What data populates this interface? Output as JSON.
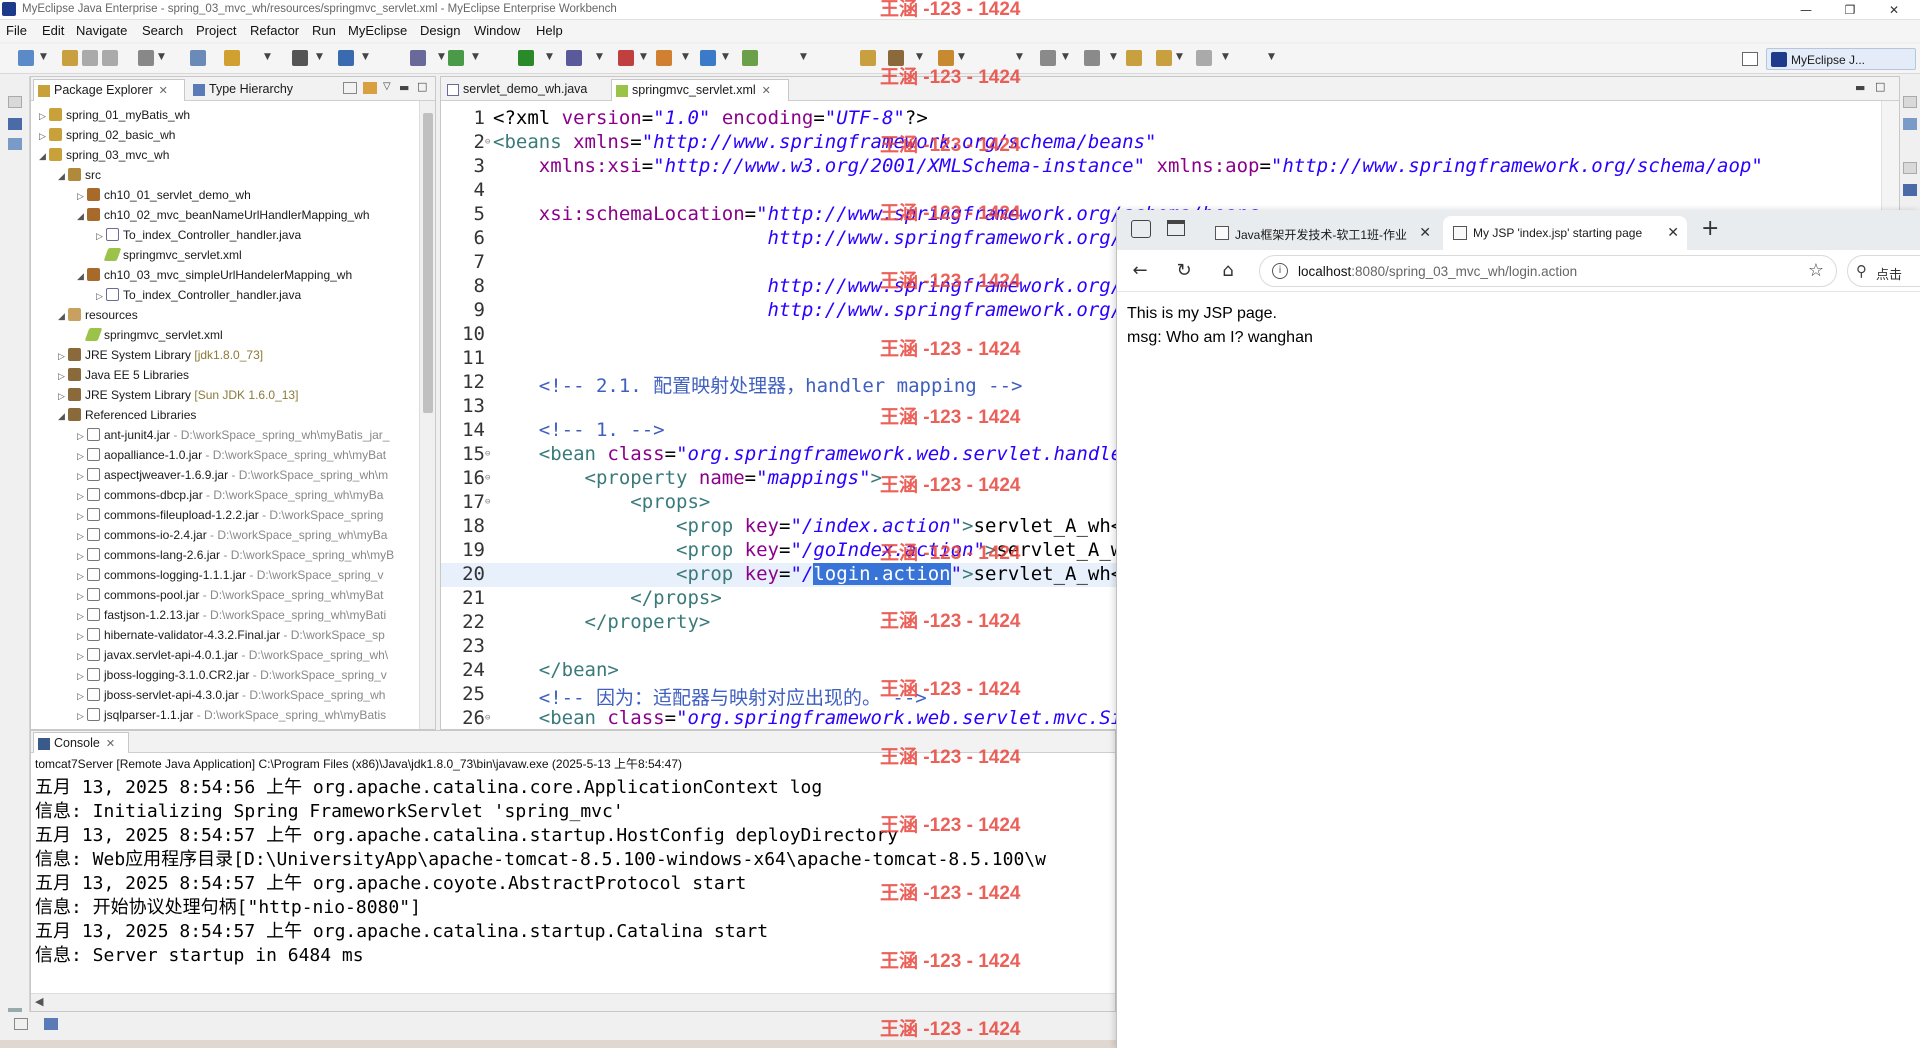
{
  "window": {
    "title": "MyEclipse Java Enterprise - spring_03_mvc_wh/resources/springmvc_servlet.xml - MyEclipse Enterprise Workbench",
    "controls": [
      "—",
      "❐",
      "✕"
    ]
  },
  "menu": [
    "File",
    "Edit",
    "Navigate",
    "Search",
    "Project",
    "Refactor",
    "Run",
    "MyEclipse",
    "Design",
    "Window",
    "Help"
  ],
  "perspective": "MyEclipse J...",
  "package_explorer": {
    "tabs": [
      "Package Explorer",
      "Type Hierarchy"
    ],
    "tree": [
      {
        "label": "spring_01_myBatis_wh",
        "icon": "project-icon",
        "indent": 0,
        "twisty": "▷"
      },
      {
        "label": "spring_02_basic_wh",
        "icon": "project-icon",
        "indent": 0,
        "twisty": "▷"
      },
      {
        "label": "spring_03_mvc_wh",
        "icon": "project-icon",
        "indent": 0,
        "twisty": "◢"
      },
      {
        "label": "src",
        "icon": "source-folder-icon",
        "indent": 1,
        "twisty": "◢"
      },
      {
        "label": "ch10_01_servlet_demo_wh",
        "icon": "package-icon",
        "indent": 2,
        "twisty": "▷"
      },
      {
        "label": "ch10_02_mvc_beanNameUrlHandlerMapping_wh",
        "icon": "package-icon",
        "indent": 2,
        "twisty": "◢"
      },
      {
        "label": "To_index_Controller_handler.java",
        "icon": "java-file-icon",
        "indent": 3,
        "twisty": "▷"
      },
      {
        "label": "springmvc_servlet.xml",
        "icon": "xml-file-icon",
        "indent": 3,
        "twisty": ""
      },
      {
        "label": "ch10_03_mvc_simpleUrlHandelerMapping_wh",
        "icon": "package-icon",
        "indent": 2,
        "twisty": "◢"
      },
      {
        "label": "To_index_Controller_handler.java",
        "icon": "java-file-icon",
        "indent": 3,
        "twisty": "▷"
      },
      {
        "label": "resources",
        "icon": "resource-folder-icon",
        "indent": 1,
        "twisty": "◢"
      },
      {
        "label": "springmvc_servlet.xml",
        "icon": "xml-file-icon",
        "indent": 2,
        "twisty": ""
      },
      {
        "label": "JRE System Library",
        "decoration": "[jdk1.8.0_73]",
        "icon": "library-icon",
        "indent": 1,
        "twisty": "▷"
      },
      {
        "label": "Java EE 5 Libraries",
        "icon": "library-icon",
        "indent": 1,
        "twisty": "▷"
      },
      {
        "label": "JRE System Library",
        "decoration": "[Sun JDK 1.6.0_13]",
        "icon": "library-icon",
        "indent": 1,
        "twisty": "▷"
      },
      {
        "label": "Referenced Libraries",
        "icon": "library-icon",
        "indent": 1,
        "twisty": "◢"
      },
      {
        "label": "ant-junit4.jar",
        "path": "- D:\\workSpace_spring_wh\\myBatis_jar_",
        "icon": "jar-icon",
        "indent": 2,
        "twisty": "▷"
      },
      {
        "label": "aopalliance-1.0.jar",
        "path": "- D:\\workSpace_spring_wh\\myBat",
        "icon": "jar-icon",
        "indent": 2,
        "twisty": "▷"
      },
      {
        "label": "aspectjweaver-1.6.9.jar",
        "path": "- D:\\workSpace_spring_wh\\m",
        "icon": "jar-icon",
        "indent": 2,
        "twisty": "▷"
      },
      {
        "label": "commons-dbcp.jar",
        "path": "- D:\\workSpace_spring_wh\\myBa",
        "icon": "jar-icon",
        "indent": 2,
        "twisty": "▷"
      },
      {
        "label": "commons-fileupload-1.2.2.jar",
        "path": "- D:\\workSpace_spring",
        "icon": "jar-icon",
        "indent": 2,
        "twisty": "▷"
      },
      {
        "label": "commons-io-2.4.jar",
        "path": "- D:\\workSpace_spring_wh\\myBa",
        "icon": "jar-icon",
        "indent": 2,
        "twisty": "▷"
      },
      {
        "label": "commons-lang-2.6.jar",
        "path": "- D:\\workSpace_spring_wh\\myB",
        "icon": "jar-icon",
        "indent": 2,
        "twisty": "▷"
      },
      {
        "label": "commons-logging-1.1.1.jar",
        "path": "- D:\\workSpace_spring_v",
        "icon": "jar-icon",
        "indent": 2,
        "twisty": "▷"
      },
      {
        "label": "commons-pool.jar",
        "path": "- D:\\workSpace_spring_wh\\myBat",
        "icon": "jar-icon",
        "indent": 2,
        "twisty": "▷"
      },
      {
        "label": "fastjson-1.2.13.jar",
        "path": "- D:\\workSpace_spring_wh\\myBati",
        "icon": "jar-icon",
        "indent": 2,
        "twisty": "▷"
      },
      {
        "label": "hibernate-validator-4.3.2.Final.jar",
        "path": "- D:\\workSpace_sp",
        "icon": "jar-icon",
        "indent": 2,
        "twisty": "▷"
      },
      {
        "label": "javax.servlet-api-4.0.1.jar",
        "path": "- D:\\workSpace_spring_wh\\",
        "icon": "jar-icon",
        "indent": 2,
        "twisty": "▷"
      },
      {
        "label": "jboss-logging-3.1.0.CR2.jar",
        "path": "- D:\\workSpace_spring_v",
        "icon": "jar-icon",
        "indent": 2,
        "twisty": "▷"
      },
      {
        "label": "jboss-servlet-api-4.3.0.jar",
        "path": "- D:\\workSpace_spring_wh",
        "icon": "jar-icon",
        "indent": 2,
        "twisty": "▷"
      },
      {
        "label": "jsqlparser-1.1.jar",
        "path": "- D:\\workSpace_spring_wh\\myBatis",
        "icon": "jar-icon",
        "indent": 2,
        "twisty": "▷"
      }
    ]
  },
  "editor": {
    "tabs": [
      {
        "label": "servlet_demo_wh.java",
        "active": false
      },
      {
        "label": "springmvc_servlet.xml",
        "active": true
      }
    ],
    "lines": [
      {
        "n": "1",
        "tokens": [
          [
            "pi",
            "<?xml "
          ],
          [
            "attr",
            "version"
          ],
          [
            "pi",
            "="
          ],
          [
            "val",
            "\"1.0\""
          ],
          [
            "pi",
            " "
          ],
          [
            "attr",
            "encoding"
          ],
          [
            "pi",
            "="
          ],
          [
            "val",
            "\"UTF-8\""
          ],
          [
            "pi",
            "?>"
          ]
        ]
      },
      {
        "n": "2",
        "fold": true,
        "tokens": [
          [
            "tag",
            "<beans "
          ],
          [
            "attr",
            "xmlns"
          ],
          [
            "pi",
            "="
          ],
          [
            "val",
            "\"http://www.springframework.org/schema/beans\""
          ]
        ]
      },
      {
        "n": "3",
        "tokens": [
          [
            "pi",
            "    "
          ],
          [
            "attr",
            "xmlns:xsi"
          ],
          [
            "pi",
            "="
          ],
          [
            "val",
            "\"http://www.w3.org/2001/XMLSchema-instance\""
          ],
          [
            "pi",
            " "
          ],
          [
            "attr",
            "xmlns:aop"
          ],
          [
            "pi",
            "="
          ],
          [
            "val",
            "\"http://www.springframework.org/schema/aop\""
          ]
        ]
      },
      {
        "n": "4",
        "tokens": []
      },
      {
        "n": "5",
        "tokens": [
          [
            "pi",
            "    "
          ],
          [
            "attr",
            "xsi:schemaLocation"
          ],
          [
            "pi",
            "="
          ],
          [
            "val",
            "\"http://www.springframework.org/schema/beans"
          ]
        ]
      },
      {
        "n": "6",
        "tokens": [
          [
            "pi",
            "                        "
          ],
          [
            "val",
            "http://www.springframework.org/schema/beans/spring-beans.xsd"
          ]
        ]
      },
      {
        "n": "7",
        "tokens": []
      },
      {
        "n": "8",
        "tokens": [
          [
            "pi",
            "                        "
          ],
          [
            "val",
            "http://www.springframework.org/schema/aop"
          ]
        ]
      },
      {
        "n": "9",
        "tokens": [
          [
            "pi",
            "                        "
          ],
          [
            "val",
            "http://www.springframework.org/schema/aop/spring-aop.xsd\">"
          ]
        ]
      },
      {
        "n": "10",
        "tokens": []
      },
      {
        "n": "11",
        "tokens": []
      },
      {
        "n": "12",
        "tokens": [
          [
            "pi",
            "    "
          ],
          [
            "com",
            "<!-- 2.1. 配置映射处理器，handler mapping -->"
          ]
        ]
      },
      {
        "n": "13",
        "tokens": []
      },
      {
        "n": "14",
        "tokens": [
          [
            "pi",
            "    "
          ],
          [
            "com",
            "<!-- 1. -->"
          ]
        ]
      },
      {
        "n": "15",
        "fold": true,
        "tokens": [
          [
            "pi",
            "    "
          ],
          [
            "tag",
            "<bean "
          ],
          [
            "attr",
            "class"
          ],
          [
            "pi",
            "="
          ],
          [
            "val",
            "\"org.springframework.web.servlet.handler.SimpleUrlHandlerMapping\">"
          ]
        ]
      },
      {
        "n": "16",
        "fold": true,
        "tokens": [
          [
            "pi",
            "        "
          ],
          [
            "tag",
            "<property "
          ],
          [
            "attr",
            "name"
          ],
          [
            "pi",
            "="
          ],
          [
            "val",
            "\"mappings\""
          ],
          [
            "tag",
            ">"
          ]
        ]
      },
      {
        "n": "17",
        "fold": true,
        "tokens": [
          [
            "pi",
            "            "
          ],
          [
            "tag",
            "<props>"
          ]
        ]
      },
      {
        "n": "18",
        "tokens": [
          [
            "pi",
            "                "
          ],
          [
            "tag",
            "<prop "
          ],
          [
            "attr",
            "key"
          ],
          [
            "pi",
            "="
          ],
          [
            "val",
            "\"/index.action\""
          ],
          [
            "tag",
            ">"
          ],
          [
            "pi",
            "servlet_A_wh</prop>"
          ]
        ]
      },
      {
        "n": "19",
        "tokens": [
          [
            "pi",
            "                "
          ],
          [
            "tag",
            "<prop "
          ],
          [
            "attr",
            "key"
          ],
          [
            "pi",
            "="
          ],
          [
            "val",
            "\"/goIndex.action\""
          ],
          [
            "tag",
            ">"
          ],
          [
            "pi",
            "servlet_A_wh</prop>"
          ]
        ]
      },
      {
        "n": "20",
        "current": true,
        "tokens": [
          [
            "pi",
            "                "
          ],
          [
            "tag",
            "<prop "
          ],
          [
            "attr",
            "key"
          ],
          [
            "pi",
            "="
          ],
          [
            "val",
            "\"/"
          ],
          [
            "sel",
            "login.action"
          ],
          [
            "val",
            "\""
          ],
          [
            "tag",
            ">"
          ],
          [
            "pi",
            "servlet_A_wh</prop>"
          ]
        ]
      },
      {
        "n": "21",
        "tokens": [
          [
            "pi",
            "            "
          ],
          [
            "tag",
            "</props>"
          ]
        ]
      },
      {
        "n": "22",
        "tokens": [
          [
            "pi",
            "        "
          ],
          [
            "tag",
            "</property>"
          ]
        ]
      },
      {
        "n": "23",
        "tokens": []
      },
      {
        "n": "24",
        "tokens": [
          [
            "pi",
            "    "
          ],
          [
            "tag",
            "</bean>"
          ]
        ]
      },
      {
        "n": "25",
        "tokens": [
          [
            "pi",
            "    "
          ],
          [
            "com",
            "<!-- 因为：适配器与映射对应出现的。 -->"
          ]
        ]
      },
      {
        "n": "26",
        "fold": true,
        "tokens": [
          [
            "pi",
            "    "
          ],
          [
            "tag",
            "<bean "
          ],
          [
            "attr",
            "class"
          ],
          [
            "pi",
            "="
          ],
          [
            "val",
            "\"org.springframework.web.servlet.mvc.SimpleControllerHandlerAdapter\"/>"
          ]
        ]
      }
    ]
  },
  "console": {
    "tab": "Console",
    "description": "tomcat7Server [Remote Java Application] C:\\Program Files (x86)\\Java\\jdk1.8.0_73\\bin\\javaw.exe (2025-5-13 上午8:54:47)",
    "lines": [
      "五月 13, 2025 8:54:56 上午 org.apache.catalina.core.ApplicationContext log",
      "信息: Initializing Spring FrameworkServlet 'spring_mvc'",
      "五月 13, 2025 8:54:57 上午 org.apache.catalina.startup.HostConfig deployDirectory",
      "信息: Web应用程序目录[D:\\UniversityApp\\apache-tomcat-8.5.100-windows-x64\\apache-tomcat-8.5.100\\w",
      "五月 13, 2025 8:54:57 上午 org.apache.coyote.AbstractProtocol start",
      "信息: 开始协议处理句柄[\"http-nio-8080\"]",
      "五月 13, 2025 8:54:57 上午 org.apache.catalina.startup.Catalina start",
      "信息: Server startup in 6484 ms"
    ]
  },
  "browser": {
    "tabs": [
      {
        "label": "Java框架开发技术-软工1班-作业",
        "active": false
      },
      {
        "label": "My JSP 'index.jsp' starting page",
        "active": true
      }
    ],
    "new_tab": "+",
    "url_host": "localhost",
    "url_rest": ":8080/spring_03_mvc_wh/login.action",
    "search_label": "点击",
    "content": [
      "This is my JSP page.",
      "msg: Who am I? wanghan"
    ]
  },
  "watermark": "王涵 -123 - 1424"
}
